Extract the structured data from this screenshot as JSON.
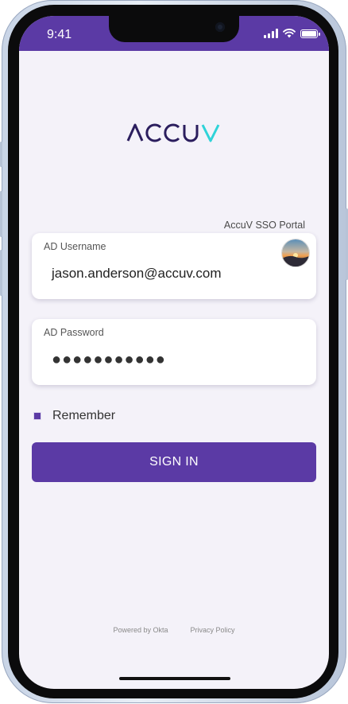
{
  "status_bar": {
    "time": "9:41",
    "icons": [
      "cellular-signal-icon",
      "wifi-icon",
      "battery-icon"
    ],
    "background": "#5b3aa5"
  },
  "brand": {
    "logo_text": "ACCUV",
    "logo_color": "#2b1e5e",
    "logo_accent": "#2fd3d8"
  },
  "portal_label": "AccuV SSO Portal",
  "username": {
    "label": "AD Username",
    "value": "jason.anderson@accuv.com"
  },
  "password": {
    "label": "AD Password",
    "value": "●●●●●●●●●●●"
  },
  "remember": {
    "label": "Remember",
    "checked": true
  },
  "sign_in_button": "SIGN IN",
  "footer": {
    "powered_by": "Powered by Okta",
    "privacy": "Privacy Policy"
  },
  "colors": {
    "primary": "#5b3aa5",
    "screen_background": "#f4f2f9"
  }
}
